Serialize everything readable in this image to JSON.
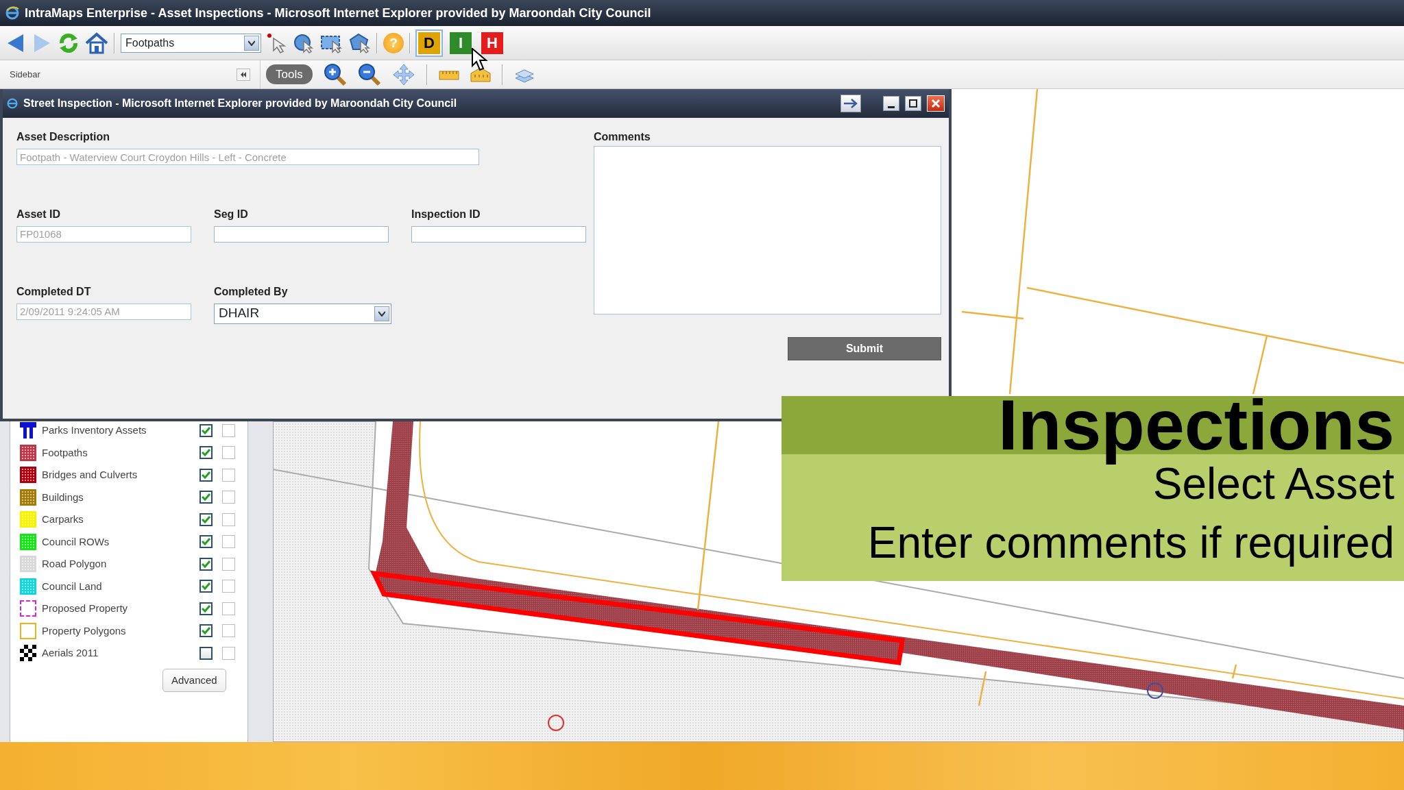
{
  "window": {
    "title": "IntraMaps Enterprise - Asset Inspections - Microsoft Internet Explorer provided by Maroondah City Council"
  },
  "toolbar": {
    "layer_select": "Footpaths",
    "help_button": "?",
    "modules": [
      {
        "label": "D",
        "color": "#e0a400",
        "selected": true
      },
      {
        "label": "I",
        "color": "#2f8a2a",
        "selected": false
      },
      {
        "label": "H",
        "color": "#e51c1c",
        "selected": false
      }
    ]
  },
  "sidebar": {
    "title": "Sidebar",
    "layers": [
      {
        "name": "Parks Inventory Assets",
        "kind": "figure",
        "color": "#1010d0",
        "visible": true,
        "selectable": false
      },
      {
        "name": "Footpaths",
        "kind": "hatched",
        "color": "#b03a48",
        "visible": true,
        "selectable": false
      },
      {
        "name": "Bridges and Culverts",
        "kind": "hatched",
        "color": "#a00010",
        "visible": true,
        "selectable": false
      },
      {
        "name": "Buildings",
        "kind": "hatched",
        "color": "#a07a10",
        "visible": true,
        "selectable": false
      },
      {
        "name": "Carparks",
        "kind": "hatched",
        "color": "#f5f000",
        "visible": true,
        "selectable": false
      },
      {
        "name": "Council ROWs",
        "kind": "hatched",
        "color": "#22e022",
        "visible": true,
        "selectable": false
      },
      {
        "name": "Road Polygon",
        "kind": "hatched",
        "color": "#d8d8d8",
        "visible": true,
        "selectable": false
      },
      {
        "name": "Council Land",
        "kind": "hatched",
        "color": "#22d0d8",
        "visible": true,
        "selectable": false
      },
      {
        "name": "Proposed Property",
        "kind": "dashed",
        "color": "#e020e0",
        "visible": true,
        "selectable": false
      },
      {
        "name": "Property Polygons",
        "kind": "outline",
        "color": "#f0b020",
        "visible": true,
        "selectable": false
      },
      {
        "name": "Aerials 2011",
        "kind": "checker",
        "color": "#000000",
        "visible": false,
        "selectable": false
      }
    ],
    "advanced_button": "Advanced"
  },
  "map_toolbar": {
    "tools_button": "Tools"
  },
  "dialog": {
    "title": "Street Inspection - Microsoft Internet Explorer provided by Maroondah City Council",
    "fields": [
      {
        "label": "Asset Description",
        "kind": "wide",
        "value": "Footpath - Waterview Court Croydon Hills - Left - Concrete",
        "disabled": true
      },
      {
        "label": "Asset ID",
        "kind": "text",
        "value": "FP01068",
        "disabled": true
      },
      {
        "label": "Seg ID",
        "kind": "text",
        "disabled": false
      },
      {
        "label": "Inspection ID",
        "kind": "text",
        "disabled": false
      },
      {
        "label": "Completed DT",
        "kind": "text",
        "value": "2/09/2011 9:24:05 AM",
        "disabled": true
      },
      {
        "label": "Completed By",
        "kind": "select",
        "value": "DHAIR",
        "disabled": false
      }
    ],
    "comments_label": "Comments",
    "submit": "Submit"
  },
  "overlay": {
    "heading": "Inspections",
    "lines": [
      "Select Asset",
      "Enter comments if required"
    ]
  }
}
